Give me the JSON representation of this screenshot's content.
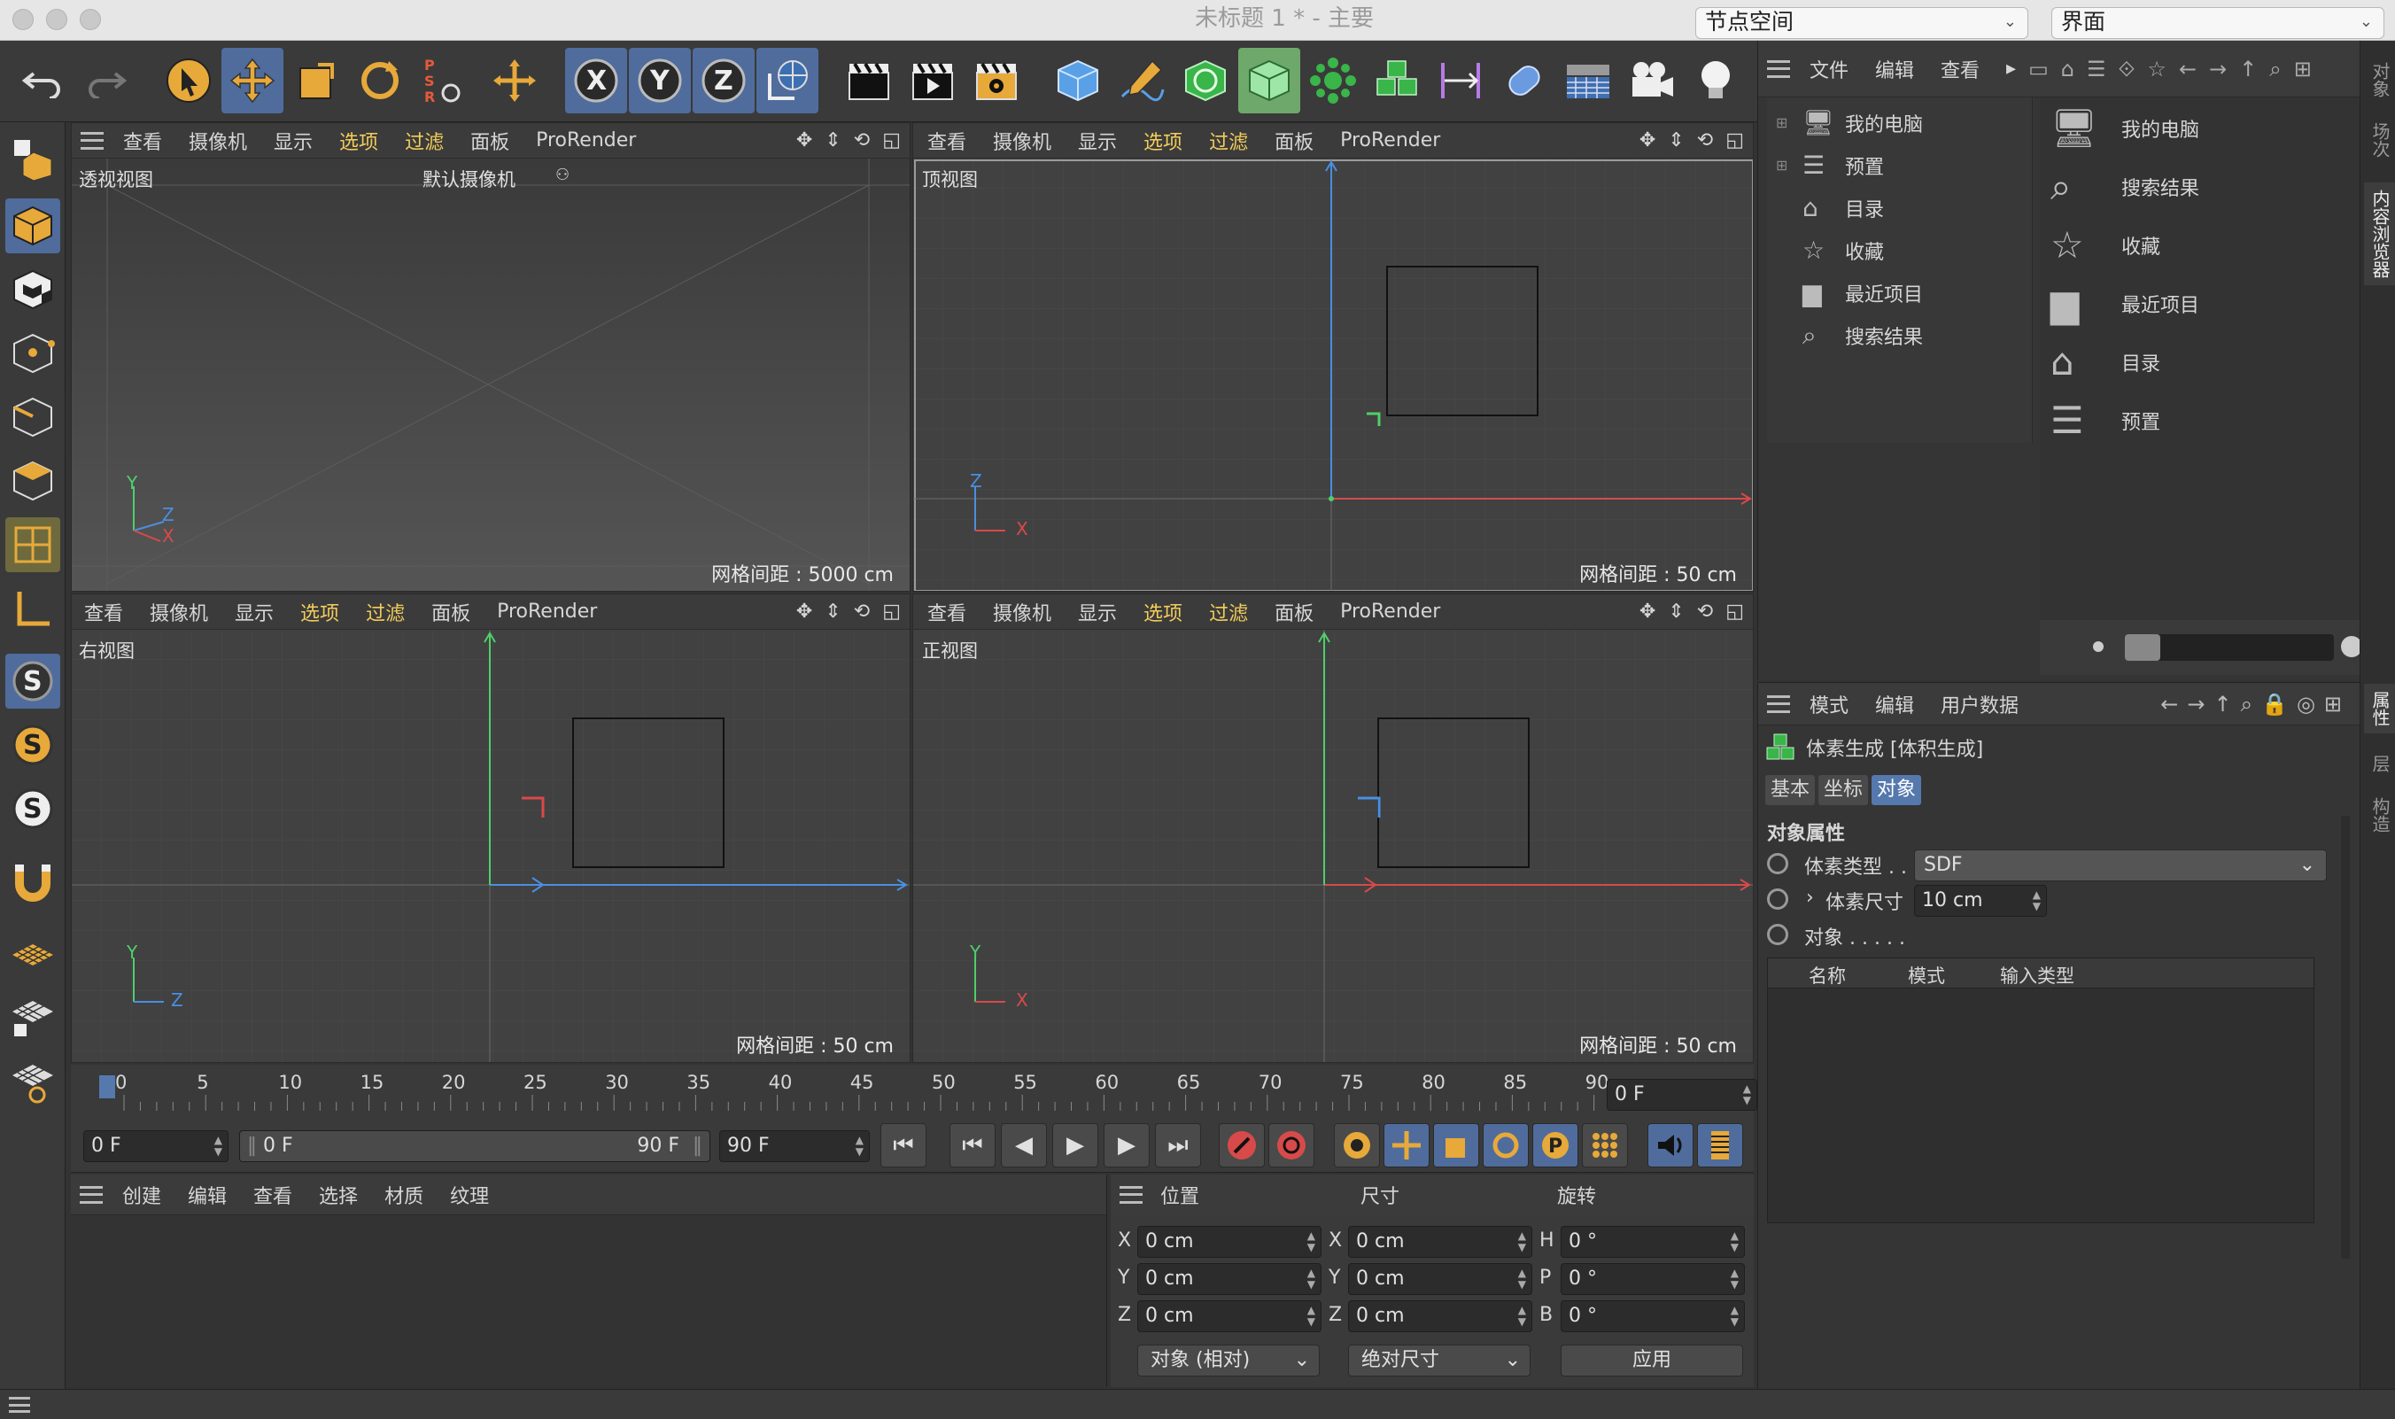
{
  "window": {
    "title": "未标题 1 * - 主要",
    "layout_select": "节点空间",
    "interface_select": "界面"
  },
  "viewport_menu": [
    "查看",
    "摄像机",
    "显示",
    "选项",
    "过滤",
    "面板",
    "ProRender"
  ],
  "viewports": [
    {
      "label": "透视视图",
      "camera": "默认摄像机",
      "grid": "网格间距 : 5000 cm",
      "axis_a": "Y",
      "axis_b": "Z",
      "axis_c": "X"
    },
    {
      "label": "顶视图",
      "grid": "网格间距 : 50 cm",
      "axis_a": "Z",
      "axis_b": "X"
    },
    {
      "label": "右视图",
      "grid": "网格间距 : 50 cm",
      "axis_a": "Y",
      "axis_b": "Z"
    },
    {
      "label": "正视图",
      "grid": "网格间距 : 50 cm",
      "axis_a": "Y",
      "axis_b": "X"
    }
  ],
  "content_browser": {
    "menu": [
      "文件",
      "编辑",
      "查看"
    ],
    "tree": [
      "我的电脑",
      "预置",
      "目录",
      "收藏",
      "最近项目",
      "搜索结果"
    ],
    "items": [
      "我的电脑",
      "搜索结果",
      "收藏",
      "最近项目",
      "目录",
      "预置"
    ],
    "side_tabs": [
      "对象",
      "场次",
      "内容浏览器"
    ]
  },
  "attributes": {
    "menu": [
      "模式",
      "编辑",
      "用户数据"
    ],
    "object_name": "体素生成 [体积生成]",
    "tabs": [
      "基本",
      "坐标",
      "对象"
    ],
    "section": "对象属性",
    "voxel_type_label": "体素类型 . .",
    "voxel_type_value": "SDF",
    "voxel_size_label": "体素尺寸",
    "voxel_size_value": "10 cm",
    "objects_label": "对象 . . . . .",
    "columns": [
      "名称",
      "模式",
      "输入类型"
    ],
    "side_tabs": [
      "属性",
      "层",
      "构造"
    ]
  },
  "timeline": {
    "ticks": [
      "0",
      "5",
      "10",
      "15",
      "20",
      "25",
      "30",
      "35",
      "40",
      "45",
      "50",
      "55",
      "60",
      "65",
      "70",
      "75",
      "80",
      "85",
      "90"
    ],
    "current_frame": "0 F",
    "start_field": "0 F",
    "range_start": "0 F",
    "range_end": "90 F",
    "end_field": "90 F"
  },
  "material_menu": [
    "创建",
    "编辑",
    "查看",
    "选择",
    "材质",
    "纹理"
  ],
  "coordinates": {
    "headers": [
      "位置",
      "尺寸",
      "旋转"
    ],
    "rows": [
      {
        "pos_axis": "X",
        "pos": "0 cm",
        "size_axis": "X",
        "size": "0 cm",
        "rot_axis": "H",
        "rot": "0 °"
      },
      {
        "pos_axis": "Y",
        "pos": "0 cm",
        "size_axis": "Y",
        "size": "0 cm",
        "rot_axis": "P",
        "rot": "0 °"
      },
      {
        "pos_axis": "Z",
        "pos": "0 cm",
        "size_axis": "Z",
        "size": "0 cm",
        "rot_axis": "B",
        "rot": "0 °"
      }
    ],
    "mode_select": "对象 (相对)",
    "size_select": "绝对尺寸",
    "apply": "应用"
  },
  "colors": {
    "accent": "#5579ad",
    "highlight_text": "#f2cd5a",
    "axis_x": "#d84a4a",
    "axis_y": "#4fcf6a",
    "axis_z": "#4a8fe0"
  }
}
